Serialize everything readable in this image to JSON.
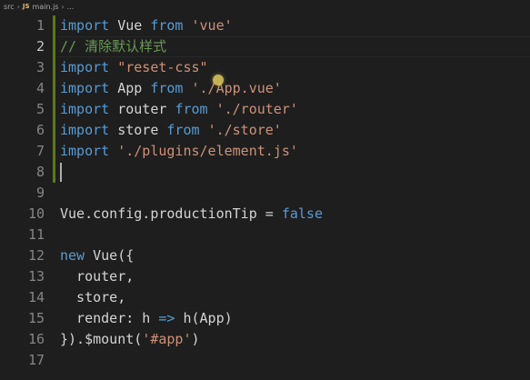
{
  "breadcrumb": {
    "folder": "src",
    "file_badge": "JS",
    "file": "main.js",
    "more": "..."
  },
  "lines": [
    {
      "n": "1",
      "tokens": [
        [
          "kw",
          "import"
        ],
        [
          "ident",
          " Vue "
        ],
        [
          "kw",
          "from"
        ],
        [
          "ident",
          " "
        ],
        [
          "str",
          "'vue'"
        ]
      ]
    },
    {
      "n": "2",
      "tokens": [
        [
          "cmt",
          "// 清除默认样式"
        ]
      ]
    },
    {
      "n": "3",
      "tokens": [
        [
          "kw",
          "import"
        ],
        [
          "ident",
          " "
        ],
        [
          "str",
          "\"reset-css\""
        ]
      ]
    },
    {
      "n": "4",
      "tokens": [
        [
          "kw",
          "import"
        ],
        [
          "ident",
          " App "
        ],
        [
          "kw",
          "from"
        ],
        [
          "ident",
          " "
        ],
        [
          "str",
          "'./App.vue'"
        ]
      ]
    },
    {
      "n": "5",
      "tokens": [
        [
          "kw",
          "import"
        ],
        [
          "ident",
          " router "
        ],
        [
          "kw",
          "from"
        ],
        [
          "ident",
          " "
        ],
        [
          "str",
          "'./router'"
        ]
      ]
    },
    {
      "n": "6",
      "tokens": [
        [
          "kw",
          "import"
        ],
        [
          "ident",
          " store "
        ],
        [
          "kw",
          "from"
        ],
        [
          "ident",
          " "
        ],
        [
          "str",
          "'./store'"
        ]
      ]
    },
    {
      "n": "7",
      "tokens": [
        [
          "kw",
          "import"
        ],
        [
          "ident",
          " "
        ],
        [
          "str",
          "'./plugins/element.js'"
        ]
      ]
    },
    {
      "n": "8",
      "tokens": []
    },
    {
      "n": "9",
      "tokens": []
    },
    {
      "n": "10",
      "tokens": [
        [
          "ident",
          "Vue.config.productionTip = "
        ],
        [
          "kw",
          "false"
        ]
      ]
    },
    {
      "n": "11",
      "tokens": []
    },
    {
      "n": "12",
      "tokens": [
        [
          "kw",
          "new"
        ],
        [
          "ident",
          " Vue({"
        ]
      ]
    },
    {
      "n": "13",
      "tokens": [
        [
          "ident",
          "  router,"
        ]
      ]
    },
    {
      "n": "14",
      "tokens": [
        [
          "ident",
          "  store,"
        ]
      ]
    },
    {
      "n": "15",
      "tokens": [
        [
          "ident",
          "  render: h "
        ],
        [
          "kw",
          "=>"
        ],
        [
          "ident",
          " h(App)"
        ]
      ]
    },
    {
      "n": "16",
      "tokens": [
        [
          "ident",
          "}).$mount("
        ],
        [
          "str",
          "'#app'"
        ],
        [
          "ident",
          ")"
        ]
      ]
    },
    {
      "n": "17",
      "tokens": []
    }
  ],
  "modified_lines": [
    "1",
    "2",
    "3",
    "4",
    "5",
    "6",
    "7",
    "8"
  ],
  "active_line": "2",
  "cursor_line": "8",
  "colors": {
    "background": "#1e1e1e",
    "keyword": "#569cd6",
    "string": "#ce9178",
    "comment": "#6a9955",
    "text": "#d4d4d4",
    "line_number": "#858585",
    "modified_gutter": "#587c0c"
  }
}
